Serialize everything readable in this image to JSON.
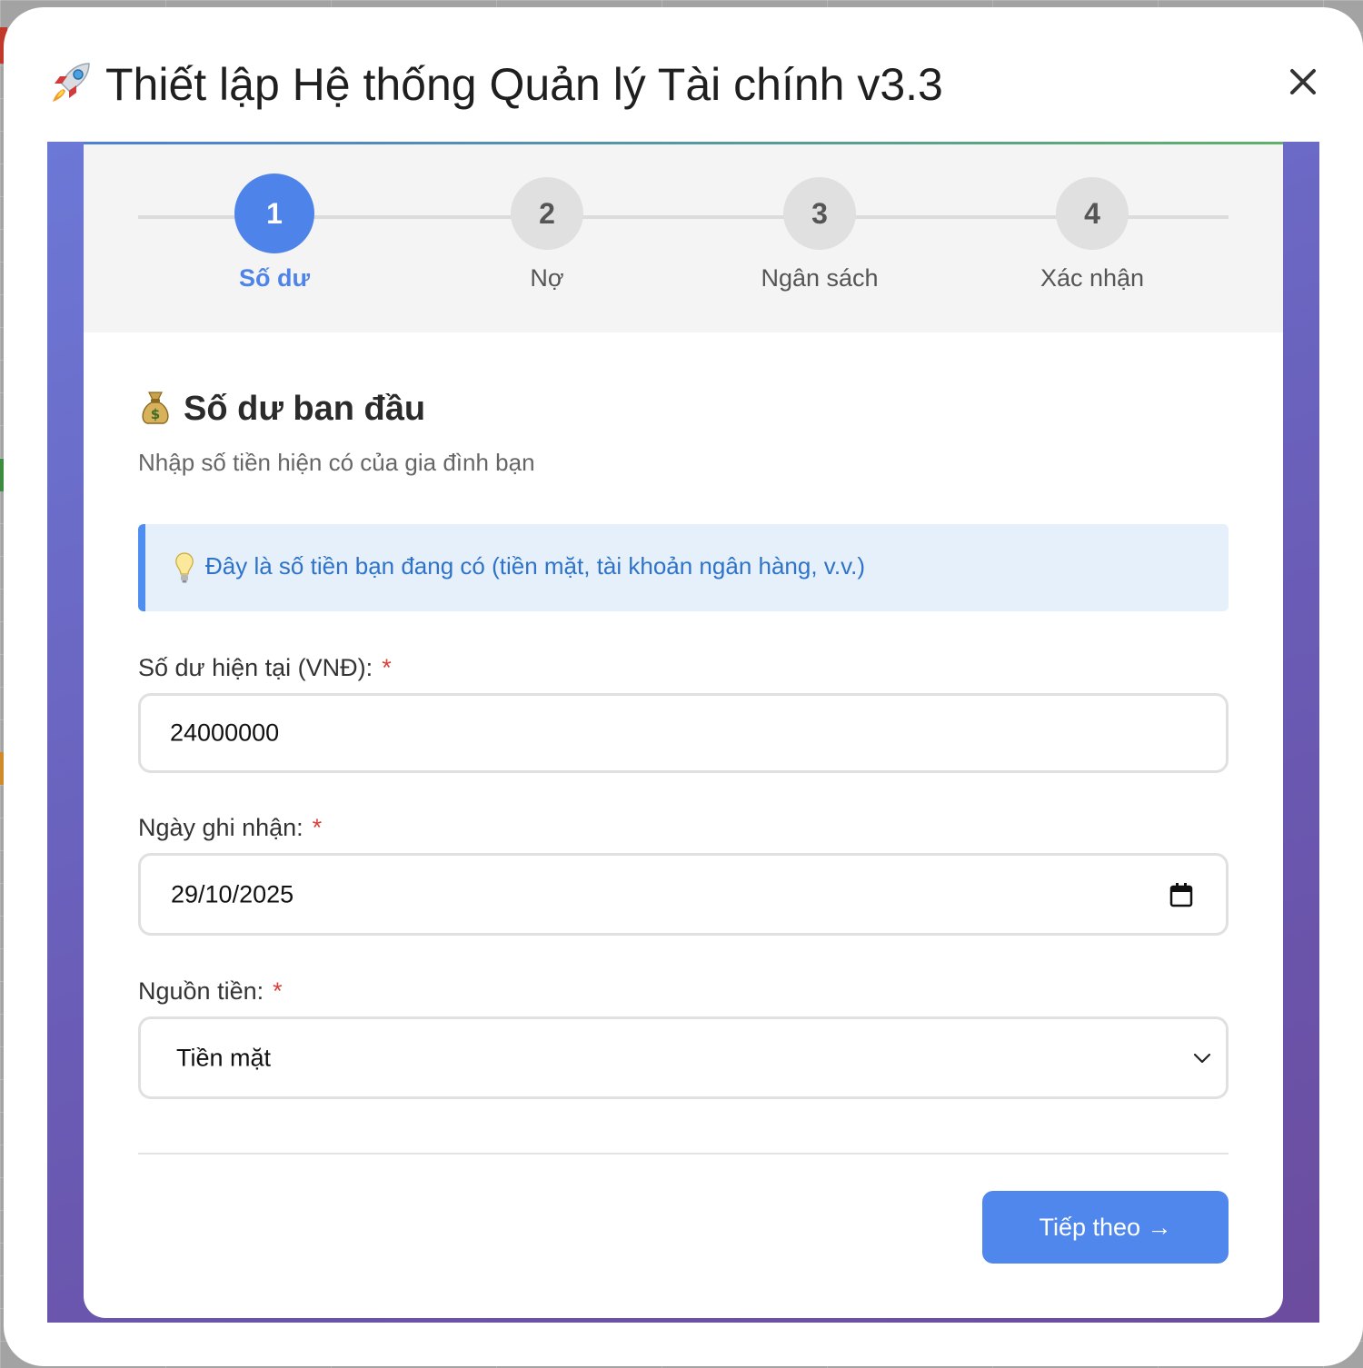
{
  "dialog": {
    "title": "Thiết lập Hệ thống Quản lý Tài chính v3.3",
    "title_icon": "rocket-icon",
    "close_icon": "close-icon"
  },
  "stepper": {
    "steps": [
      {
        "number": "1",
        "label": "Số dư",
        "active": true
      },
      {
        "number": "2",
        "label": "Nợ",
        "active": false
      },
      {
        "number": "3",
        "label": "Ngân sách",
        "active": false
      },
      {
        "number": "4",
        "label": "Xác nhận",
        "active": false
      }
    ]
  },
  "section": {
    "icon": "money-bag-icon",
    "title": "Số dư ban đầu",
    "subtitle": "Nhập số tiền hiện có của gia đình bạn"
  },
  "info": {
    "icon": "lightbulb-icon",
    "text": "Đây là số tiền bạn đang có (tiền mặt, tài khoản ngân hàng, v.v.)"
  },
  "form": {
    "balance": {
      "label": "Số dư hiện tại (VNĐ):",
      "required": "*",
      "value": "24000000"
    },
    "date": {
      "label": "Ngày ghi nhận:",
      "required": "*",
      "value": "29/10/2025"
    },
    "source": {
      "label": "Nguồn tiền:",
      "required": "*",
      "value": "Tiền mặt"
    }
  },
  "actions": {
    "next_label": "Tiếp theo →"
  },
  "colors": {
    "accent": "#4e84ea",
    "info_bg": "#e5f0fb",
    "info_text": "#2f73c8",
    "required": "#d9413a",
    "frame_gradient_start": "#6c78d6",
    "frame_gradient_end": "#6b4c9e"
  }
}
